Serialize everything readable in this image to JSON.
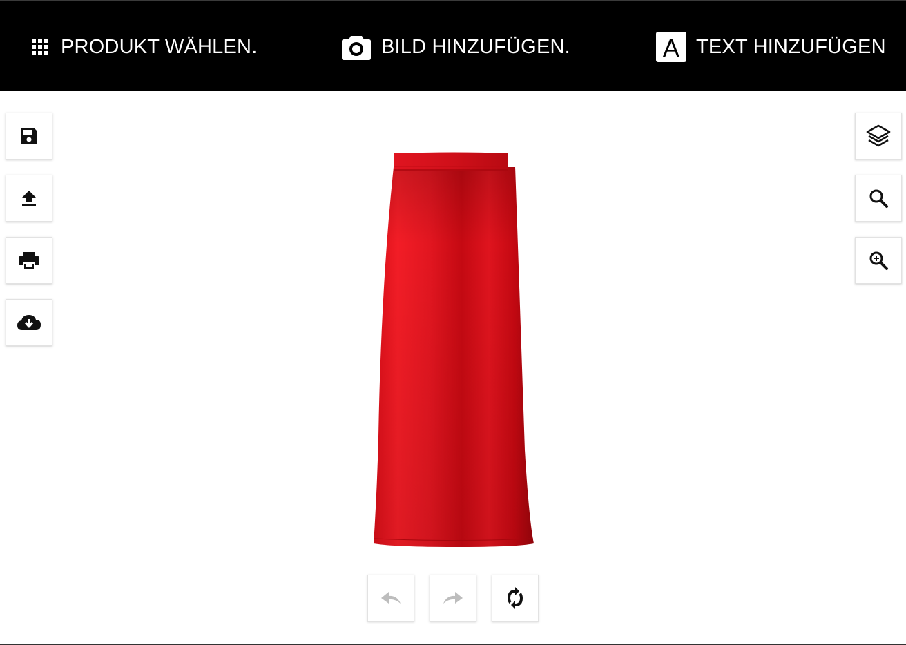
{
  "toolbar": {
    "product_label": "PRODUKT WÄHLEN.",
    "image_label": "BILD HINZUFÜGEN.",
    "text_label": "TEXT HINZUFÜGEN",
    "text_icon_letter": "A",
    "icons": [
      "grid-icon",
      "camera-icon",
      "text-icon"
    ]
  },
  "left_tools": [
    {
      "name": "save",
      "icon": "save-icon"
    },
    {
      "name": "upload",
      "icon": "upload-icon"
    },
    {
      "name": "print",
      "icon": "print-icon"
    },
    {
      "name": "download",
      "icon": "cloud-download-icon"
    }
  ],
  "right_tools": [
    {
      "name": "layers",
      "icon": "layers-icon"
    },
    {
      "name": "search",
      "icon": "search-icon"
    },
    {
      "name": "zoom-in",
      "icon": "zoom-in-icon"
    }
  ],
  "bottom_tools": [
    {
      "name": "undo",
      "icon": "undo-icon",
      "enabled": false
    },
    {
      "name": "redo",
      "icon": "redo-icon",
      "enabled": false
    },
    {
      "name": "reset",
      "icon": "refresh-icon",
      "enabled": true
    }
  ],
  "product": {
    "type": "apron",
    "color": "#e0121c"
  },
  "colors": {
    "topbar": "#000000",
    "topbar_text": "#ffffff",
    "icon": "#111111",
    "icon_disabled": "#bdbdbd"
  }
}
